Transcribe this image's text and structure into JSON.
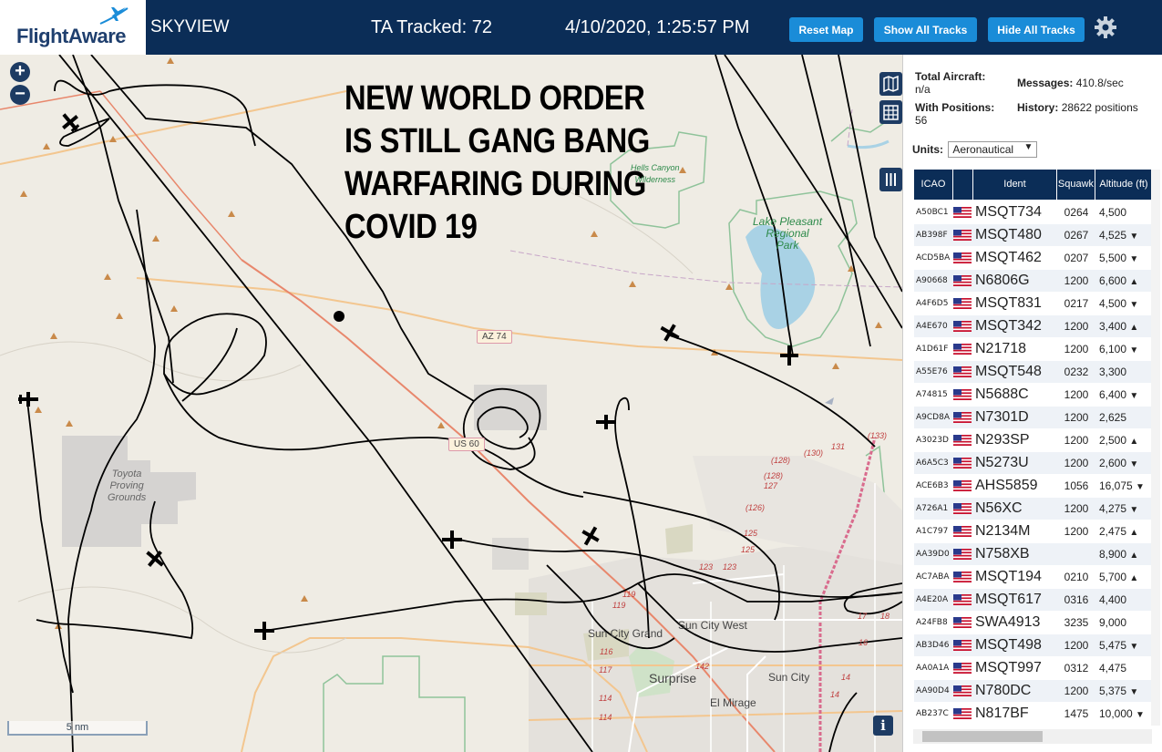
{
  "header": {
    "logo": "FlightAware",
    "title": "SKYVIEW",
    "ta_tracked": "TA Tracked: 72",
    "datetime": "4/10/2020, 1:25:57 PM",
    "buttons": {
      "reset": "Reset Map",
      "show_all": "Show All Tracks",
      "hide_all": "Hide All Tracks"
    },
    "settings_icon": "gear-icon"
  },
  "map": {
    "overlay_text": [
      "NEW WORLD ORDER",
      "IS STILL GANG BANG",
      "WARFARING DURING",
      "COVID 19"
    ],
    "zoom_in": "+",
    "zoom_out": "−",
    "scale": "5 nm",
    "info": "i",
    "places": {
      "sun_city_grand": "Sun City Grand",
      "sun_city_west": "Sun City West",
      "surprise": "Surprise",
      "sun_city": "Sun City",
      "el_mirage": "El Mirage",
      "toyota": "Toyota\nProving\nGrounds",
      "lake_pleasant": "Lake Pleasant\nRegional\nPark",
      "hells_canyon": "Hells Canyon\nWilderness"
    },
    "shields": {
      "az74": "AZ 74",
      "us60": "US 60"
    },
    "route_numbers": [
      "(128)",
      "(130)",
      "131",
      "(133)",
      "(128)",
      "127",
      "(126)",
      "125",
      "125",
      "123",
      "123",
      "119",
      "119",
      "116",
      "117",
      "142",
      "114",
      "114",
      "14",
      "14",
      "17",
      "18",
      "16"
    ]
  },
  "sidebar": {
    "total_aircraft_label": "Total Aircraft:",
    "total_aircraft_value": "n/a",
    "with_positions_label": "With Positions:",
    "with_positions_value": "56",
    "messages_label": "Messages:",
    "messages_value": "410.8/sec",
    "history_label": "History:",
    "history_value": "28622 positions",
    "units_label": "Units:",
    "units_value": "Aeronautical",
    "columns": {
      "icao": "ICAO",
      "ident": "Ident",
      "squawk": "Squawk",
      "altitude": "Altitude (ft)"
    },
    "rows": [
      {
        "icao": "A50BC1",
        "ident": "MSQT734",
        "squawk": "0264",
        "alt": "4,500",
        "trend": ""
      },
      {
        "icao": "AB398F",
        "ident": "MSQT480",
        "squawk": "0267",
        "alt": "4,525",
        "trend": "▼"
      },
      {
        "icao": "ACD5BA",
        "ident": "MSQT462",
        "squawk": "0207",
        "alt": "5,500",
        "trend": "▼"
      },
      {
        "icao": "A90668",
        "ident": "N6806G",
        "squawk": "1200",
        "alt": "6,600",
        "trend": "▲"
      },
      {
        "icao": "A4F6D5",
        "ident": "MSQT831",
        "squawk": "0217",
        "alt": "4,500",
        "trend": "▼"
      },
      {
        "icao": "A4E670",
        "ident": "MSQT342",
        "squawk": "1200",
        "alt": "3,400",
        "trend": "▲"
      },
      {
        "icao": "A1D61F",
        "ident": "N21718",
        "squawk": "1200",
        "alt": "6,100",
        "trend": "▼"
      },
      {
        "icao": "A55E76",
        "ident": "MSQT548",
        "squawk": "0232",
        "alt": "3,300",
        "trend": ""
      },
      {
        "icao": "A74815",
        "ident": "N5688C",
        "squawk": "1200",
        "alt": "6,400",
        "trend": "▼"
      },
      {
        "icao": "A9CD8A",
        "ident": "N7301D",
        "squawk": "1200",
        "alt": "2,625",
        "trend": ""
      },
      {
        "icao": "A3023D",
        "ident": "N293SP",
        "squawk": "1200",
        "alt": "2,500",
        "trend": "▲"
      },
      {
        "icao": "A6A5C3",
        "ident": "N5273U",
        "squawk": "1200",
        "alt": "2,600",
        "trend": "▼"
      },
      {
        "icao": "ACE6B3",
        "ident": "AHS5859",
        "squawk": "1056",
        "alt": "16,075",
        "trend": "▼"
      },
      {
        "icao": "A726A1",
        "ident": "N56XC",
        "squawk": "1200",
        "alt": "4,275",
        "trend": "▼"
      },
      {
        "icao": "A1C797",
        "ident": "N2134M",
        "squawk": "1200",
        "alt": "2,475",
        "trend": "▲"
      },
      {
        "icao": "AA39D0",
        "ident": "N758XB",
        "squawk": "",
        "alt": "8,900",
        "trend": "▲"
      },
      {
        "icao": "AC7ABA",
        "ident": "MSQT194",
        "squawk": "0210",
        "alt": "5,700",
        "trend": "▲"
      },
      {
        "icao": "A4E20A",
        "ident": "MSQT617",
        "squawk": "0316",
        "alt": "4,400",
        "trend": ""
      },
      {
        "icao": "A24FB8",
        "ident": "SWA4913",
        "squawk": "3235",
        "alt": "9,000",
        "trend": ""
      },
      {
        "icao": "AB3D46",
        "ident": "MSQT498",
        "squawk": "1200",
        "alt": "5,475",
        "trend": "▼"
      },
      {
        "icao": "AA0A1A",
        "ident": "MSQT997",
        "squawk": "0312",
        "alt": "4,475",
        "trend": ""
      },
      {
        "icao": "AA90D4",
        "ident": "N780DC",
        "squawk": "1200",
        "alt": "5,375",
        "trend": "▼"
      },
      {
        "icao": "AB237C",
        "ident": "N817BF",
        "squawk": "1475",
        "alt": "10,000",
        "trend": "▼"
      }
    ]
  }
}
